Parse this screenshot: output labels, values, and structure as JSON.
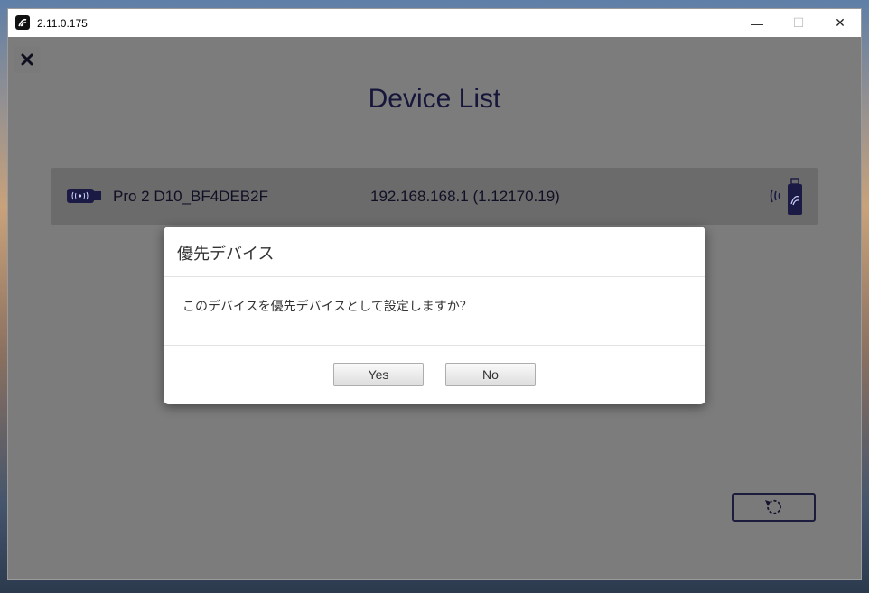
{
  "window": {
    "version": "2.11.0.175",
    "minimize_glyph": "—",
    "maximize_glyph": "☐",
    "close_glyph": "✕"
  },
  "page": {
    "title": "Device List"
  },
  "device": {
    "name": "Pro 2 D10_BF4DEB2F",
    "ip": "192.168.168.1 (1.12170.19)"
  },
  "dialog": {
    "title": "優先デバイス",
    "message": "このデバイスを優先デバイスとして設定しますか？",
    "yes_label": "Yes",
    "no_label": "No"
  },
  "icons": {
    "close": "close-icon",
    "dongle": "usb-dongle-icon",
    "wireless": "wireless-dongle-icon",
    "refresh": "refresh-icon",
    "app": "app-logo-icon"
  },
  "colors": {
    "overlay": "#7c7c7c",
    "device_row": "#6b6b6b",
    "title_text": "#16163a",
    "dialog_bg": "#ffffff"
  }
}
